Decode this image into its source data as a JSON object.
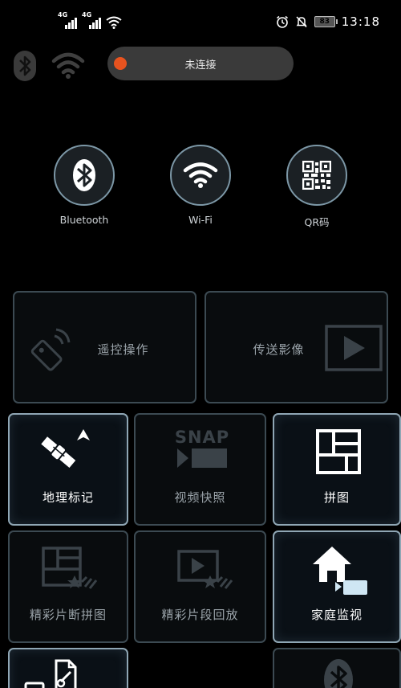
{
  "status_bar": {
    "signal_1_label": "4G",
    "signal_2_label": "4G",
    "battery_level": "83",
    "time": "13:18"
  },
  "top_bar": {
    "connection_status": "未连接",
    "status_dot_color": "#e8531f"
  },
  "connect_options": [
    {
      "label": "Bluetooth",
      "icon": "bluetooth-icon"
    },
    {
      "label": "Wi-Fi",
      "icon": "wifi-icon"
    },
    {
      "label": "QR码",
      "icon": "qr-code-icon"
    }
  ],
  "tiles": {
    "remote_control": {
      "label": "遥控操作",
      "icon": "remote-control-icon",
      "enabled": false
    },
    "send_image": {
      "label": "传送影像",
      "icon": "play-screen-icon",
      "enabled": false
    },
    "geotag": {
      "label": "地理标记",
      "icon": "satellite-location-icon",
      "enabled": true
    },
    "video_snapshot": {
      "label": "视频快照",
      "icon": "snap-icon",
      "icon_text": "SNAP",
      "enabled": false
    },
    "collage": {
      "label": "拼图",
      "icon": "collage-icon",
      "enabled": true
    },
    "highlight_collage": {
      "label": "精彩片断拼图",
      "icon": "highlight-collage-icon",
      "enabled": false
    },
    "highlight_playback": {
      "label": "精彩片段回放",
      "icon": "highlight-playback-icon",
      "enabled": false
    },
    "home_monitor": {
      "label": "家庭监视",
      "icon": "home-camera-icon",
      "enabled": true
    },
    "file_settings": {
      "label": "",
      "icon": "file-settings-icon",
      "enabled": true
    },
    "bluetooth_tile": {
      "label": "",
      "icon": "bluetooth-icon",
      "enabled": false
    }
  },
  "colors": {
    "background": "#000000",
    "accent_border": "#8fa6b4",
    "disabled_border": "#3c4a52"
  }
}
